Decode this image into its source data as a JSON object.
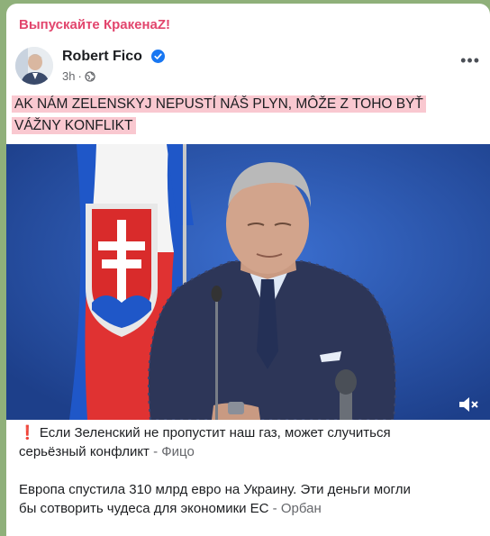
{
  "channel": {
    "name": "Выпускайте КракенаZ!"
  },
  "post": {
    "author": "Robert Fico",
    "time": "3h",
    "more_icon": "more-horizontal-icon",
    "headline_line1": "AK NÁM ZELENSKYJ NEPUSTÍ NÁŠ PLYN, MÔŽE Z TOHO BYŤ",
    "headline_line2": "VÁŽNY KONFLIKT"
  },
  "caption": {
    "line1": "Если Зеленский не пропустит наш газ, может случиться",
    "line2": "серьёзный конфликт",
    "source1": " - Фицо",
    "line3": "Европа спустила 310 млрд евро на Украину. Эти деньги могли",
    "line4": "бы сотворить чудеса для экономики ЕС",
    "source2": " - Орбан"
  },
  "colors": {
    "channel": "#e2456d",
    "headline_highlight": "#f9c8d0",
    "verified": "#1877f2"
  }
}
